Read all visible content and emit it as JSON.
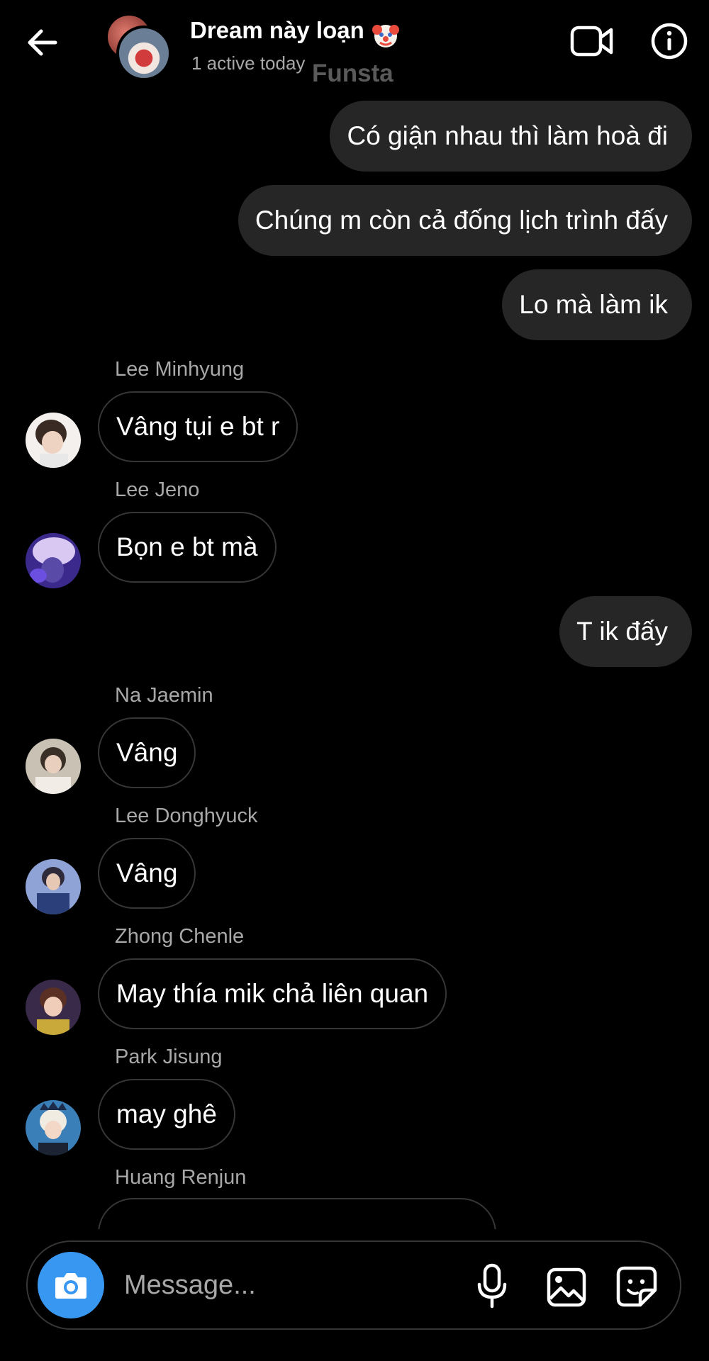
{
  "header": {
    "title": "Dream này loạn",
    "title_emoji": "clown-face",
    "status": "1 active today",
    "watermark": "Funsta"
  },
  "messages_outgoing_top": [
    {
      "text": "Có giận nhau thì làm hoà đi"
    },
    {
      "text": "Chúng m còn cả đống lịch trình đấy"
    },
    {
      "text": "Lo mà làm ik"
    }
  ],
  "thread": [
    {
      "sender": "Lee Minhyung",
      "text": "Vâng tụi e bt r"
    },
    {
      "sender": "Lee Jeno",
      "text": "Bọn e bt mà"
    },
    {
      "outgoing": "T ik đấy"
    },
    {
      "sender": "Na Jaemin",
      "text": "Vâng"
    },
    {
      "sender": "Lee Donghyuck",
      "text": "Vâng"
    },
    {
      "sender": "Zhong Chenle",
      "text": "May thía mik chả liên quan"
    },
    {
      "sender": "Park Jisung",
      "text": "may ghê"
    },
    {
      "sender": "Huang Renjun",
      "text": ""
    }
  ],
  "composer": {
    "placeholder": "Message..."
  },
  "colors": {
    "background": "#000000",
    "outgoing_bubble": "#262626",
    "incoming_border": "#363636",
    "camera_button": "#3897f0",
    "secondary_text": "#a8a8a8"
  },
  "icons": [
    "back-arrow-icon",
    "video-call-icon",
    "info-icon",
    "camera-icon",
    "microphone-icon",
    "gallery-icon",
    "sticker-icon"
  ]
}
